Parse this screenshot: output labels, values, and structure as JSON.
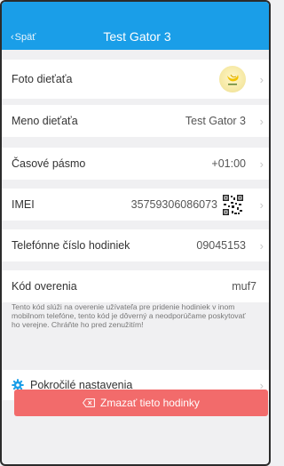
{
  "header": {
    "back_label": "Späť",
    "title": "Test Gator 3",
    "bg_color": "#1a9ee8"
  },
  "rows": {
    "photo": {
      "label": "Foto dieťaťa",
      "avatar_icon": "banana-logo-icon"
    },
    "name": {
      "label": "Meno dieťaťa",
      "value": "Test Gator 3"
    },
    "timezone": {
      "label": "Časové pásmo",
      "value": "+01:00"
    },
    "imei": {
      "label": "IMEI",
      "value": "35759306086073",
      "qr_icon": "qr-code-icon"
    },
    "phone": {
      "label": "Telefónne číslo hodiniek",
      "value": "09045153"
    },
    "code": {
      "label": "Kód overenia",
      "value": "muf7"
    }
  },
  "note": "Tento kód slúži na overenie užívateľa pre pridenie hodiniek v inom mobilnom telefóne, tento kód je dôverný a neodporúčame poskytovať ho verejne. Chráňte ho pred zenužitím!",
  "advanced": {
    "label": "Pokročilé nastavenia",
    "icon": "gear-icon"
  },
  "delete": {
    "label": "Zmazať tieto hodinky",
    "icon": "backspace-icon",
    "color": "#f26b6b"
  }
}
